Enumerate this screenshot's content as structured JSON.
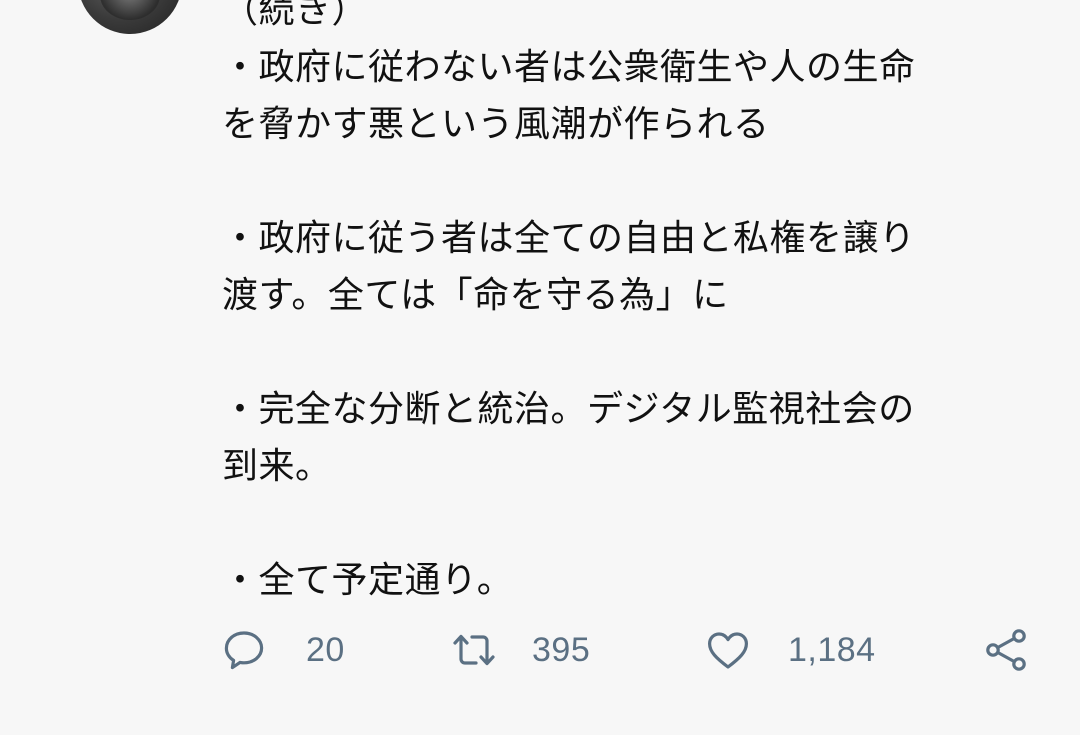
{
  "tweet": {
    "lines": [
      "（続き）",
      "・政府に従わない者は公衆衛生や人の生命",
      "を脅かす悪という風潮が作られる",
      "",
      "・政府に従う者は全ての自由と私権を譲り",
      "渡す。全ては「命を守る為」に",
      "",
      "・完全な分断と統治。デジタル監視社会の",
      "到来。",
      "",
      "・全て予定通り。"
    ]
  },
  "actions": {
    "reply": {
      "icon": "reply-icon",
      "count": "20"
    },
    "retweet": {
      "icon": "retweet-icon",
      "count": "395"
    },
    "like": {
      "icon": "heart-icon",
      "count": "1,184"
    },
    "share": {
      "icon": "share-icon"
    }
  },
  "colors": {
    "background": "#f7f7f7",
    "text": "#111111",
    "action_gray": "#5b7083"
  }
}
